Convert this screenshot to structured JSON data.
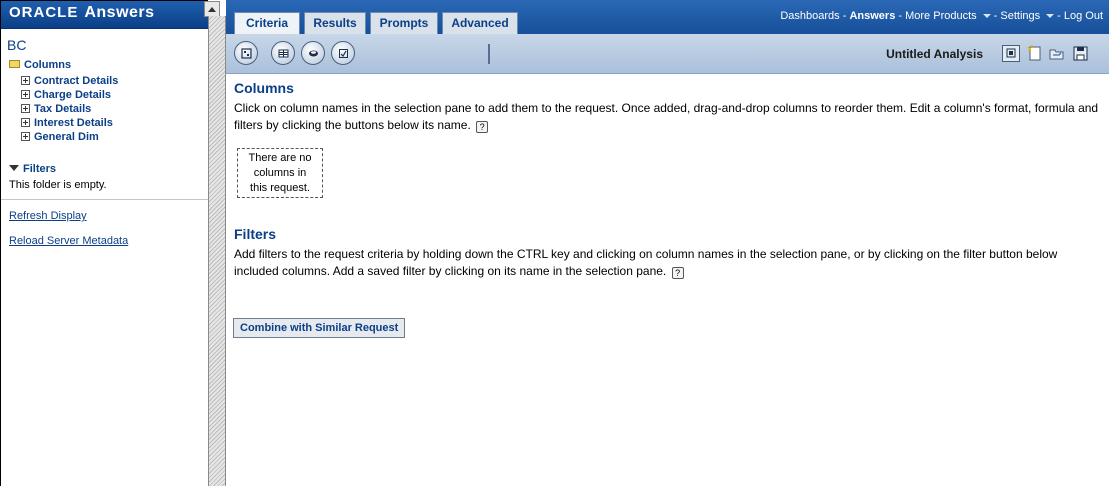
{
  "left": {
    "logo": {
      "oracle": "ORACLE",
      "answers": "Answers"
    },
    "subject_area": "BC",
    "columns_folder": "Columns",
    "items": [
      {
        "label": "Contract Details"
      },
      {
        "label": "Charge Details"
      },
      {
        "label": "Tax Details"
      },
      {
        "label": "Interest Details"
      },
      {
        "label": "General Dim"
      }
    ],
    "filters_folder": "Filters",
    "filters_empty": "This folder is empty.",
    "refresh_link": "Refresh Display",
    "reload_link": "Reload Server Metadata"
  },
  "tabs": [
    {
      "label": "Criteria",
      "active": true
    },
    {
      "label": "Results",
      "active": false
    },
    {
      "label": "Prompts",
      "active": false
    },
    {
      "label": "Advanced",
      "active": false
    }
  ],
  "top_links": {
    "dashboards": "Dashboards",
    "answers": "Answers",
    "more_products": "More Products",
    "settings": "Settings",
    "logout": "Log Out",
    "sep": "-"
  },
  "toolbar": {
    "analysis_name": "Untitled Analysis",
    "buttons": [
      "table-view-icon",
      "column-grid-icon",
      "sql-disk-icon",
      "refresh-icon"
    ],
    "right_buttons": [
      "display-results-icon",
      "new-request-icon",
      "open-folder-icon",
      "save-icon"
    ]
  },
  "columns_section": {
    "title": "Columns",
    "text": "Click on column names in the selection pane to add them to the request. Once added, drag-and-drop columns to reorder them. Edit a column's format, formula and filters by clicking the buttons below its name.",
    "empty_line1": "There are no",
    "empty_line2": "columns in",
    "empty_line3": "this request."
  },
  "filters_section": {
    "title": "Filters",
    "text": "Add filters to the request criteria by holding down the CTRL key and clicking on column names in the selection pane, or by clicking on the filter button below included columns. Add a saved filter by clicking on its name in the selection pane."
  },
  "combine_button": "Combine with Similar Request",
  "colors": {
    "brand_blue": "#0b3f87",
    "topbar": "#174f99",
    "toolbar": "#aac0db"
  }
}
